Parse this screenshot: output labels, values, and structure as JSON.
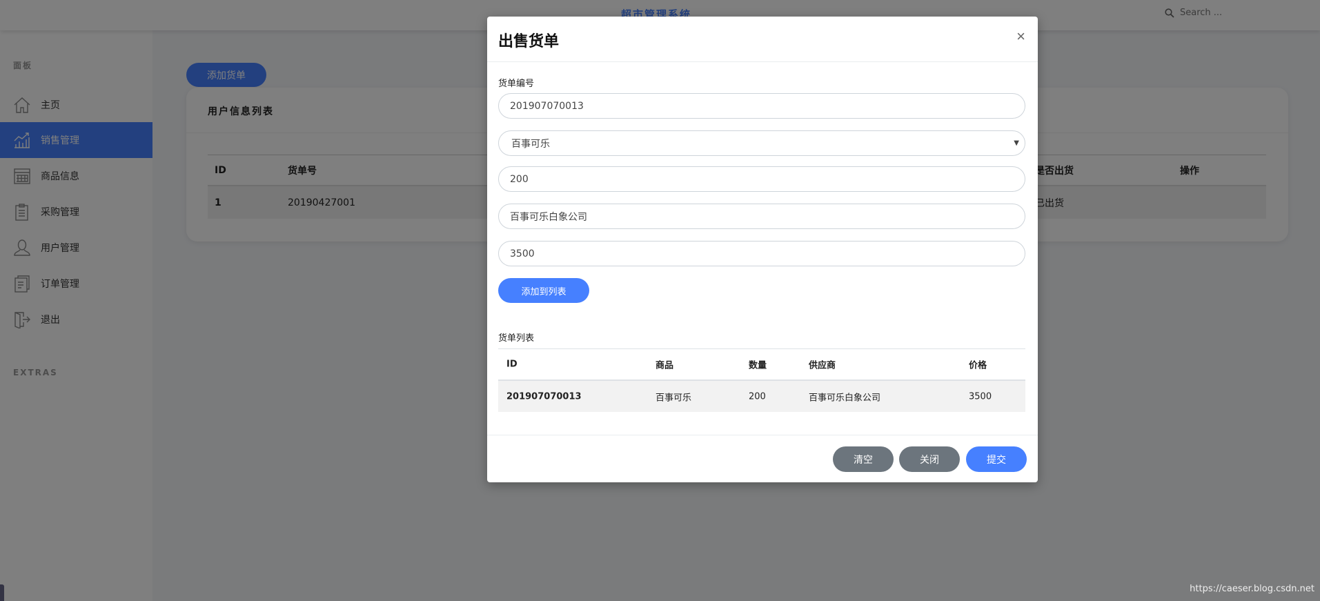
{
  "header": {
    "title": "超市管理系统",
    "search_placeholder": "Search ..."
  },
  "sidebar": {
    "section1": "面板",
    "section2": "EXTRAS",
    "items": [
      {
        "label": "主页",
        "icon": "home-icon"
      },
      {
        "label": "销售管理",
        "icon": "chart-icon",
        "active": true
      },
      {
        "label": "商品信息",
        "icon": "calendar-icon"
      },
      {
        "label": "采购管理",
        "icon": "clipboard-icon"
      },
      {
        "label": "用户管理",
        "icon": "user-icon"
      },
      {
        "label": "订单管理",
        "icon": "document-icon"
      },
      {
        "label": "退出",
        "icon": "logout-icon"
      }
    ]
  },
  "main": {
    "add_button": "添加货单",
    "card_title": "用户信息列表",
    "table": {
      "headers": [
        "ID",
        "货单号",
        "是否出货",
        "操作"
      ],
      "rows": [
        [
          "1",
          "20190427001",
          "已出货",
          ""
        ]
      ]
    }
  },
  "modal": {
    "title": "出售货单",
    "close": "×",
    "field_label": "货单编号",
    "order_id": "201907070013",
    "product": "百事可乐",
    "quantity": "200",
    "supplier": "百事可乐白象公司",
    "price": "3500",
    "add_to_list": "添加到列表",
    "list_label": "货单列表",
    "table": {
      "headers": [
        "ID",
        "商品",
        "数量",
        "供应商",
        "价格"
      ],
      "rows": [
        [
          "201907070013",
          "百事可乐",
          "200",
          "百事可乐白象公司",
          "3500"
        ]
      ]
    },
    "buttons": {
      "clear": "清空",
      "close": "关闭",
      "submit": "提交"
    }
  },
  "watermark": "https://caeser.blog.csdn.net",
  "colors": {
    "accent": "#4680ff",
    "secondary": "#6c757d"
  }
}
